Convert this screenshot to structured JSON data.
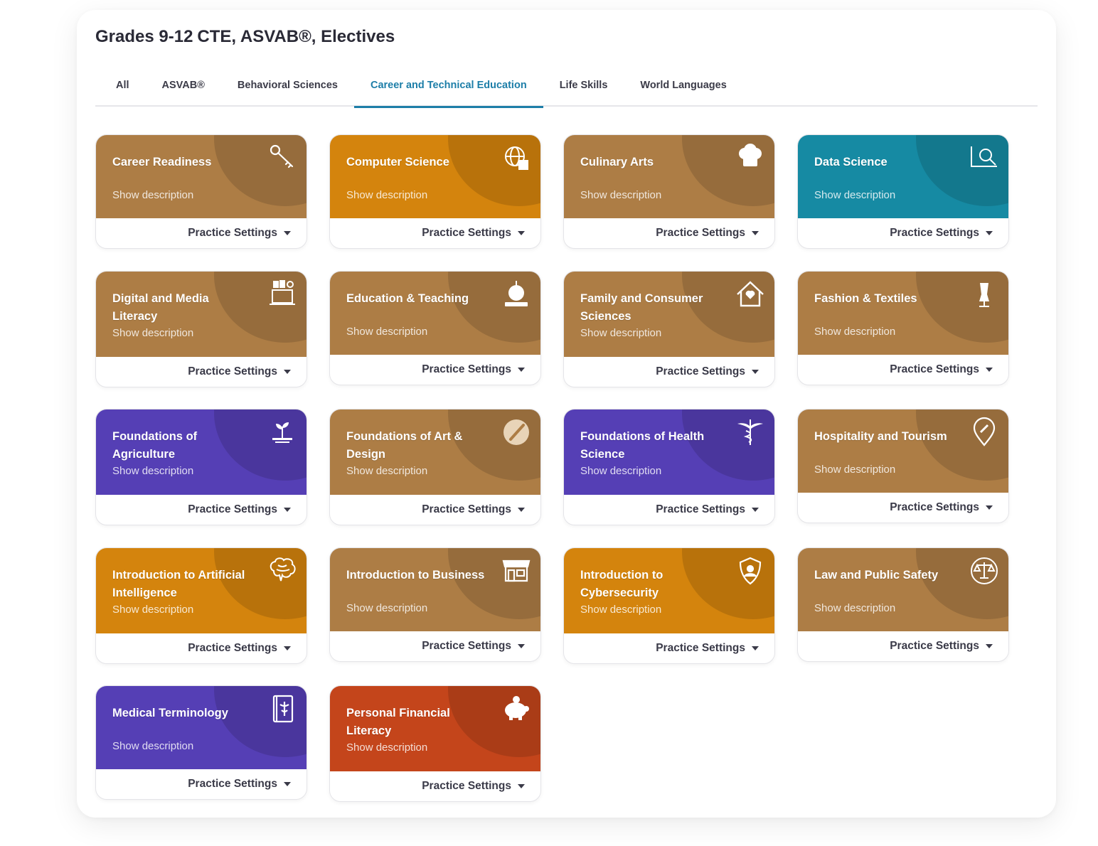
{
  "header": {
    "grade": "Grades 9-12",
    "subtitle": "CTE, ASVAB®, Electives"
  },
  "tabs": [
    {
      "label": "All",
      "active": false
    },
    {
      "label": "ASVAB®",
      "active": false
    },
    {
      "label": "Behavioral Sciences",
      "active": false
    },
    {
      "label": "Career and Technical Education",
      "active": true
    },
    {
      "label": "Life Skills",
      "active": false
    },
    {
      "label": "World Languages",
      "active": false
    }
  ],
  "colors": {
    "brown": "#ad7d45",
    "orange": "#d4840d",
    "teal": "#168aa3",
    "purple": "#553fb5",
    "red": "#c4451b",
    "tab_active": "#1d7ea8"
  },
  "labels": {
    "show_description": "Show description",
    "practice_settings": "Practice Settings"
  },
  "cards": [
    {
      "title": "Career Readiness",
      "color": "brown",
      "icon": "key-icon"
    },
    {
      "title": "Computer Science",
      "color": "orange",
      "icon": "globe-chip-icon"
    },
    {
      "title": "Culinary Arts",
      "color": "brown",
      "icon": "chef-hat-icon"
    },
    {
      "title": "Data Science",
      "color": "teal",
      "icon": "chart-magnifier-icon"
    },
    {
      "title": "Digital and Media Literacy",
      "color": "brown",
      "icon": "laptop-media-icon"
    },
    {
      "title": "Education & Teaching",
      "color": "brown",
      "icon": "apple-book-icon"
    },
    {
      "title": "Family and Consumer Sciences",
      "color": "brown",
      "icon": "house-heart-icon"
    },
    {
      "title": "Fashion & Textiles",
      "color": "brown",
      "icon": "dress-form-icon"
    },
    {
      "title": "Foundations of Agriculture",
      "color": "purple",
      "icon": "sprout-icon"
    },
    {
      "title": "Foundations of Art & Design",
      "color": "brown",
      "icon": "palette-brush-icon"
    },
    {
      "title": "Foundations of Health Science",
      "color": "purple",
      "icon": "caduceus-icon"
    },
    {
      "title": "Hospitality and Tourism",
      "color": "brown",
      "icon": "location-pin-icon"
    },
    {
      "title": "Introduction to Artificial Intelligence",
      "color": "orange",
      "icon": "brain-icon"
    },
    {
      "title": "Introduction to Business",
      "color": "brown",
      "icon": "storefront-icon"
    },
    {
      "title": "Introduction to Cybersecurity",
      "color": "orange",
      "icon": "shield-user-icon"
    },
    {
      "title": "Law and Public Safety",
      "color": "brown",
      "icon": "scales-icon"
    },
    {
      "title": "Medical Terminology",
      "color": "purple",
      "icon": "medical-book-icon"
    },
    {
      "title": "Personal Financial Literacy",
      "color": "red",
      "icon": "piggy-bank-icon"
    }
  ]
}
